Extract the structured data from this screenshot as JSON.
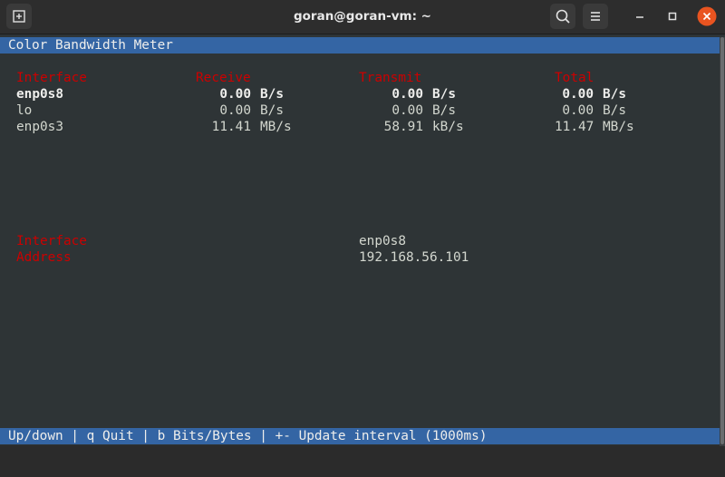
{
  "titlebar": {
    "title": "goran@goran-vm: ~",
    "icons": [
      "new-tab-icon",
      "search-icon",
      "hamburger-menu-icon",
      "minimize-icon",
      "maximize-icon",
      "close-icon"
    ]
  },
  "app": {
    "title": "Color Bandwidth Meter",
    "headers": {
      "interface": "Interface",
      "receive": "Receive",
      "transmit": "Transmit",
      "total": "Total"
    },
    "rows": [
      {
        "iface": "enp0s8",
        "rx_val": "0.00",
        "rx_unit": "B/s",
        "tx_val": "0.00",
        "tx_unit": "B/s",
        "tot_val": "0.00",
        "tot_unit": "B/s",
        "selected": true
      },
      {
        "iface": "lo",
        "rx_val": "0.00",
        "rx_unit": "B/s",
        "tx_val": "0.00",
        "tx_unit": "B/s",
        "tot_val": "0.00",
        "tot_unit": "B/s",
        "selected": false
      },
      {
        "iface": "enp0s3",
        "rx_val": "11.41",
        "rx_unit": "MB/s",
        "tx_val": "58.91",
        "tx_unit": "kB/s",
        "tot_val": "11.47",
        "tot_unit": "MB/s",
        "selected": false
      }
    ],
    "details": {
      "interface_label": "Interface",
      "interface_value": "enp0s8",
      "address_label": "Address",
      "address_value": "192.168.56.101"
    },
    "footer": "Up/down | q Quit | b Bits/Bytes | +- Update interval (1000ms)"
  },
  "colors": {
    "terminal_bg": "#2e3436",
    "bar_bg": "#3465a4",
    "header_red": "#cc0000",
    "close_orange": "#e95420"
  }
}
